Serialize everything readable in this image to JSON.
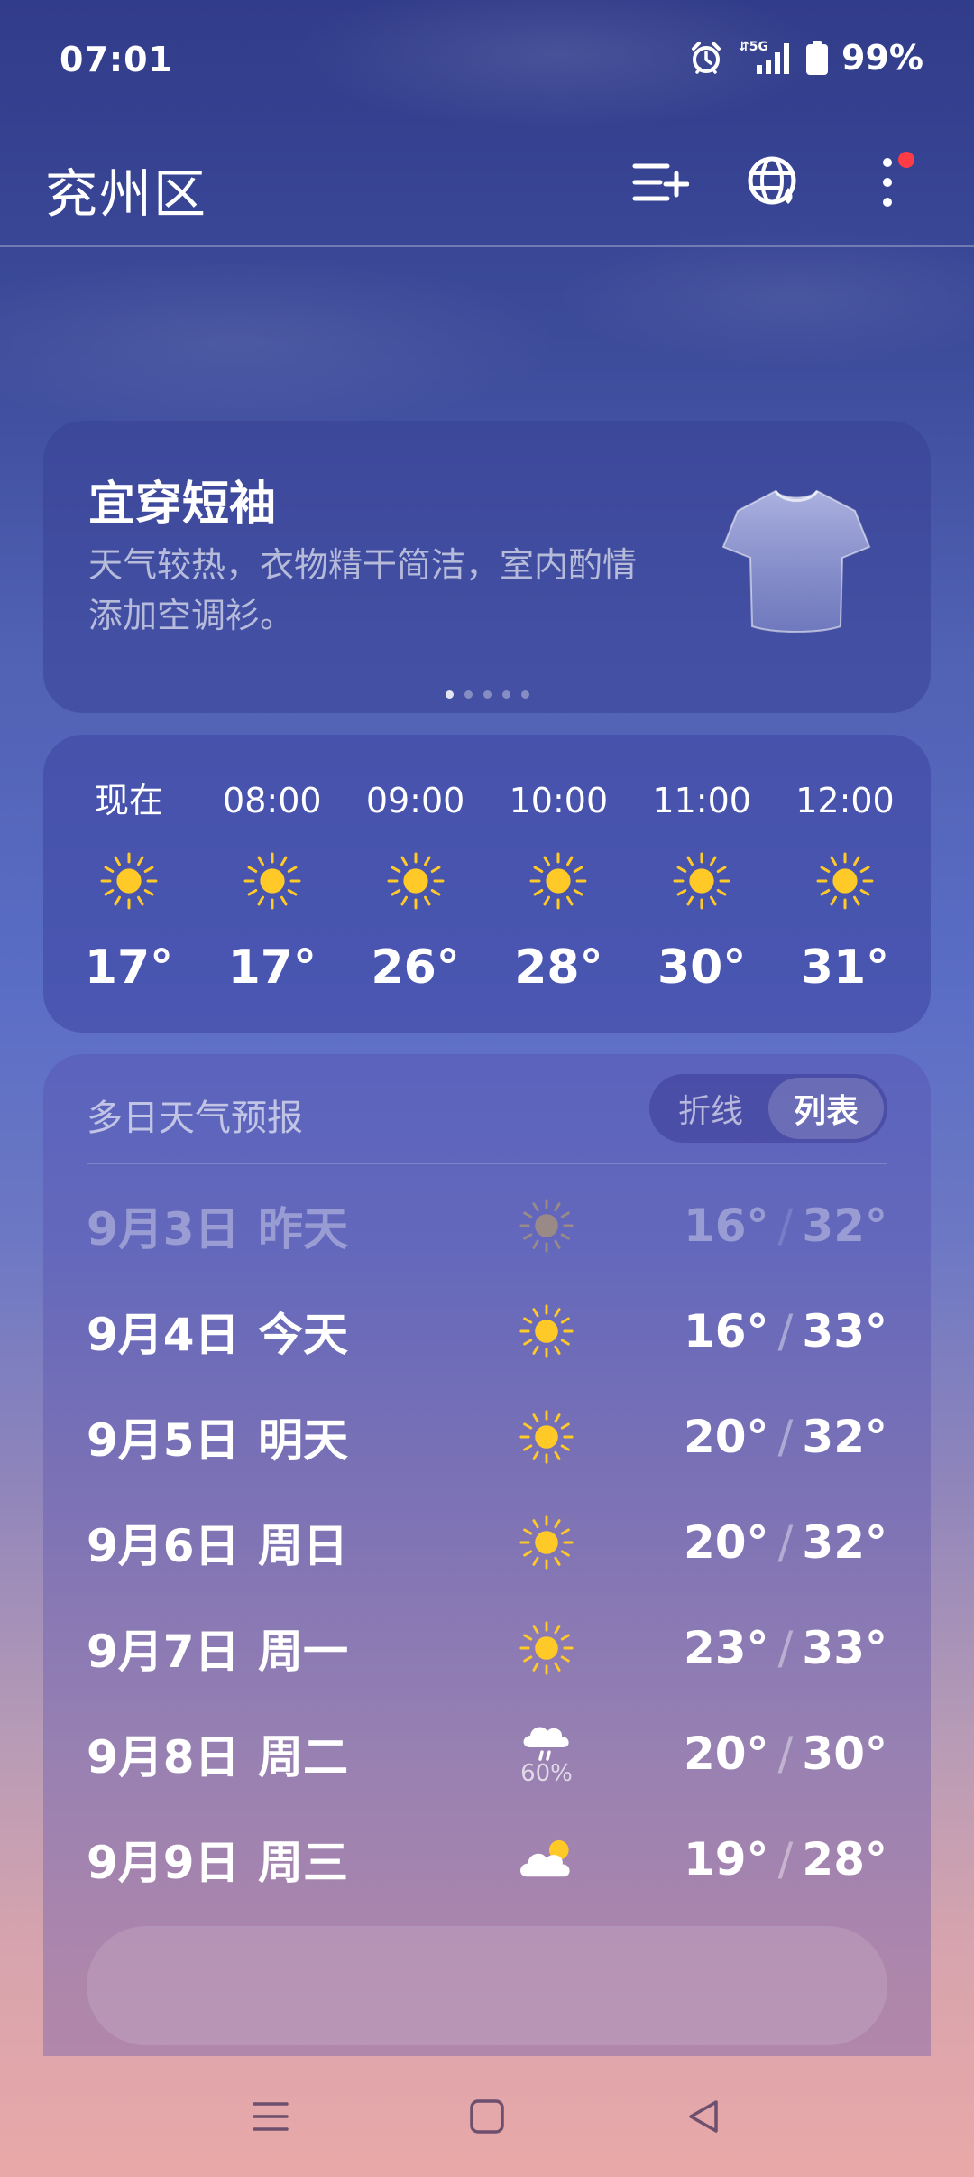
{
  "status_bar": {
    "time": "07:01",
    "network": "5G",
    "battery": "99%"
  },
  "header": {
    "city": "兖州区",
    "icons": [
      "add-city-icon",
      "globe-icon",
      "more-icon"
    ]
  },
  "clothing": {
    "title": "宜穿短袖",
    "description": "天气较热，衣物精干简洁，室内酌情添加空调衫。",
    "icon": "tshirt-icon",
    "page_count": 5,
    "active_page": 1
  },
  "hourly": [
    {
      "time": "现在",
      "icon": "sunny-icon",
      "temp": "17°"
    },
    {
      "time": "08:00",
      "icon": "sunny-icon",
      "temp": "17°"
    },
    {
      "time": "09:00",
      "icon": "sunny-icon",
      "temp": "26°"
    },
    {
      "time": "10:00",
      "icon": "sunny-icon",
      "temp": "28°"
    },
    {
      "time": "11:00",
      "icon": "sunny-icon",
      "temp": "30°"
    },
    {
      "time": "12:00",
      "icon": "sunny-icon",
      "temp": "31°"
    }
  ],
  "forecast": {
    "title": "多日天气预报",
    "toggle": {
      "option_line": "折线",
      "option_list": "列表",
      "selected": "列表"
    },
    "days": [
      {
        "date": "9月3日",
        "day": "昨天",
        "icon": "sunny-icon",
        "precip": "",
        "low": "16°",
        "high": "32°",
        "past": true
      },
      {
        "date": "9月4日",
        "day": "今天",
        "icon": "sunny-icon",
        "precip": "",
        "low": "16°",
        "high": "33°",
        "past": false
      },
      {
        "date": "9月5日",
        "day": "明天",
        "icon": "sunny-icon",
        "precip": "",
        "low": "20°",
        "high": "32°",
        "past": false
      },
      {
        "date": "9月6日",
        "day": "周日",
        "icon": "sunny-icon",
        "precip": "",
        "low": "20°",
        "high": "32°",
        "past": false
      },
      {
        "date": "9月7日",
        "day": "周一",
        "icon": "sunny-icon",
        "precip": "",
        "low": "23°",
        "high": "33°",
        "past": false
      },
      {
        "date": "9月8日",
        "day": "周二",
        "icon": "rain-icon",
        "precip": "60%",
        "low": "20°",
        "high": "30°",
        "past": false
      },
      {
        "date": "9月9日",
        "day": "周三",
        "icon": "partly-cloudy-icon",
        "precip": "",
        "low": "19°",
        "high": "28°",
        "past": false
      }
    ]
  },
  "colors": {
    "sun": "#FFC928",
    "notification_dot": "#FF3B46"
  }
}
